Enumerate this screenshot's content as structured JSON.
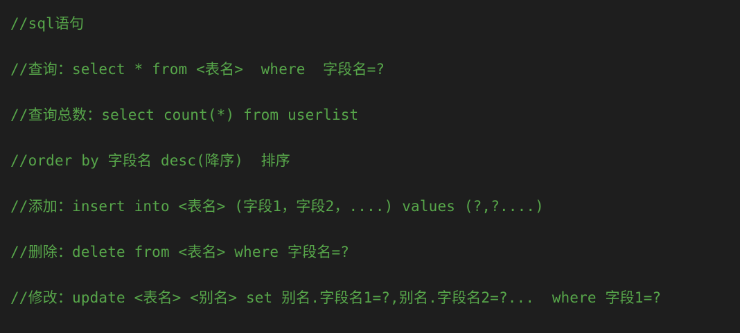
{
  "editor": {
    "background": "#1e1e1e",
    "comment_color": "#57a64a",
    "lines": [
      "//sql语句",
      "",
      "//查询：select * from <表名>  where  字段名=?",
      "",
      "//查询总数：select count(*) from userlist",
      "",
      "//order by 字段名 desc(降序)  排序",
      "",
      "//添加：insert into <表名> (字段1，字段2，....) values (?,?....)",
      "",
      "//删除：delete from <表名> where 字段名=?",
      "",
      "//修改：update <表名> <别名> set 别名.字段名1=?,别名.字段名2=?...  where 字段1=?"
    ]
  }
}
